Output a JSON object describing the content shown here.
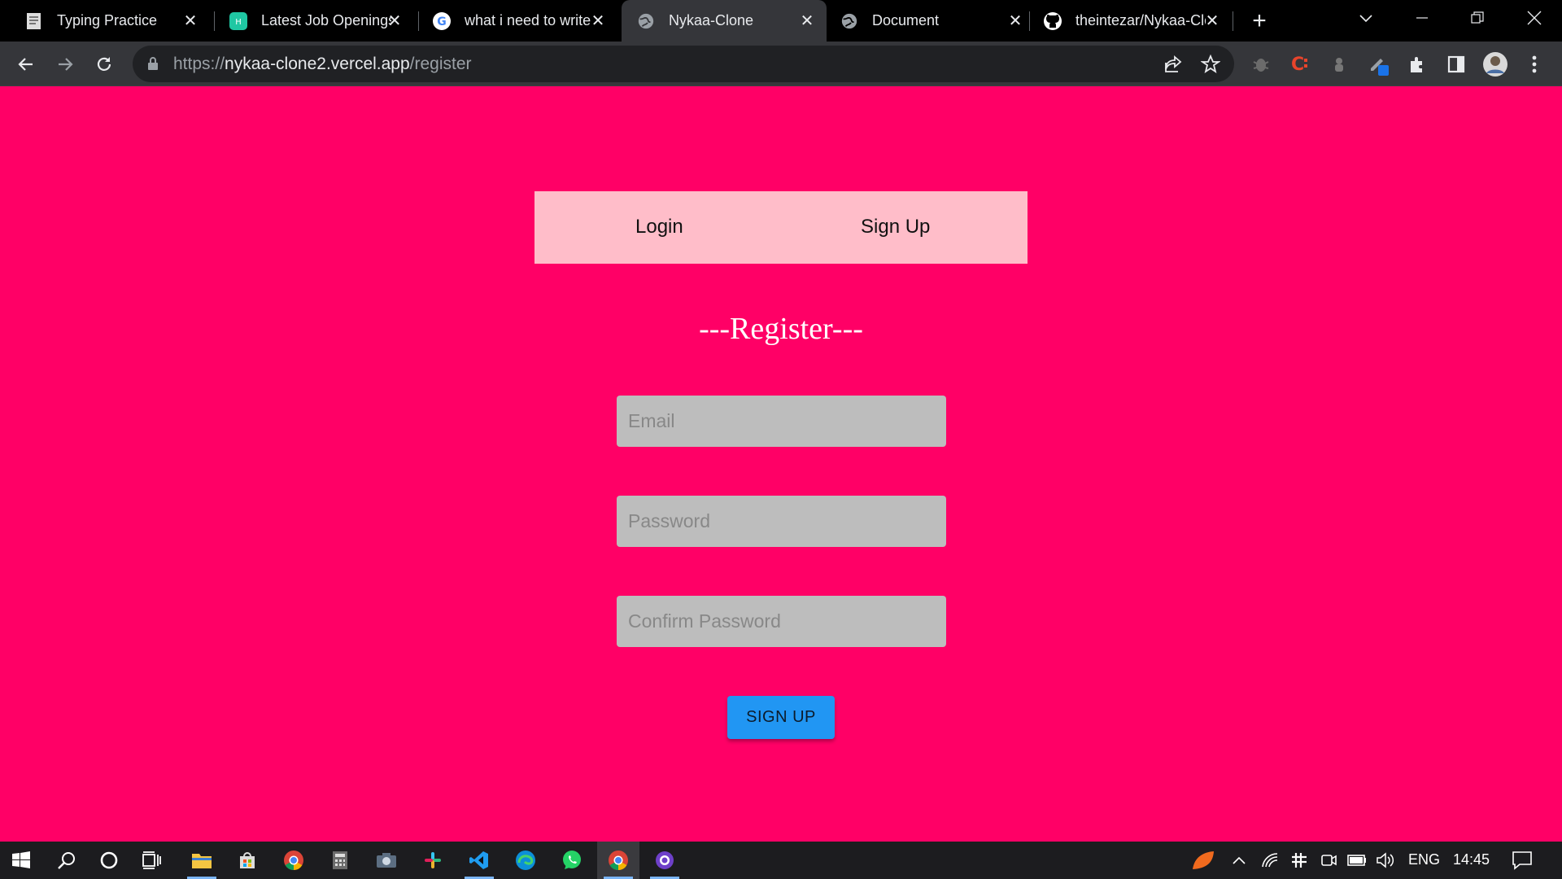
{
  "browser": {
    "tabs": [
      {
        "title": "Typing Practice",
        "icon": "notepad-icon"
      },
      {
        "title": "Latest Job Openings",
        "icon": "job-site-icon"
      },
      {
        "title": "what i need to write",
        "icon": "google-icon"
      },
      {
        "title": "Nykaa-Clone",
        "icon": "globe-icon",
        "active": true
      },
      {
        "title": "Document",
        "icon": "globe-icon"
      },
      {
        "title": "theintezar/Nykaa-Clone",
        "icon": "github-icon"
      }
    ],
    "url_scheme": "https://",
    "url_host": "nykaa-clone2.vercel.app",
    "url_path": "/register"
  },
  "page": {
    "nav_login": "Login",
    "nav_signup": "Sign Up",
    "heading": "---Register---",
    "email_placeholder": "Email",
    "password_placeholder": "Password",
    "confirm_placeholder": "Confirm Password",
    "submit_label": "SIGN UP"
  },
  "taskbar": {
    "language": "ENG",
    "time": "14:45",
    "apps": [
      "windows-start-icon",
      "search-icon",
      "cortana-icon",
      "task-view-icon",
      "file-explorer-icon",
      "microsoft-store-icon",
      "chrome-icon",
      "calculator-icon",
      "camera-icon",
      "slack-icon",
      "vscode-icon",
      "edge-icon",
      "whatsapp-icon",
      "chrome-icon",
      "github-desktop-icon"
    ]
  },
  "colors": {
    "page_background": "#ff0066",
    "auth_tabs_background": "#ffbdc9",
    "input_background": "#bdbdbd",
    "button_background": "#2196f3"
  }
}
